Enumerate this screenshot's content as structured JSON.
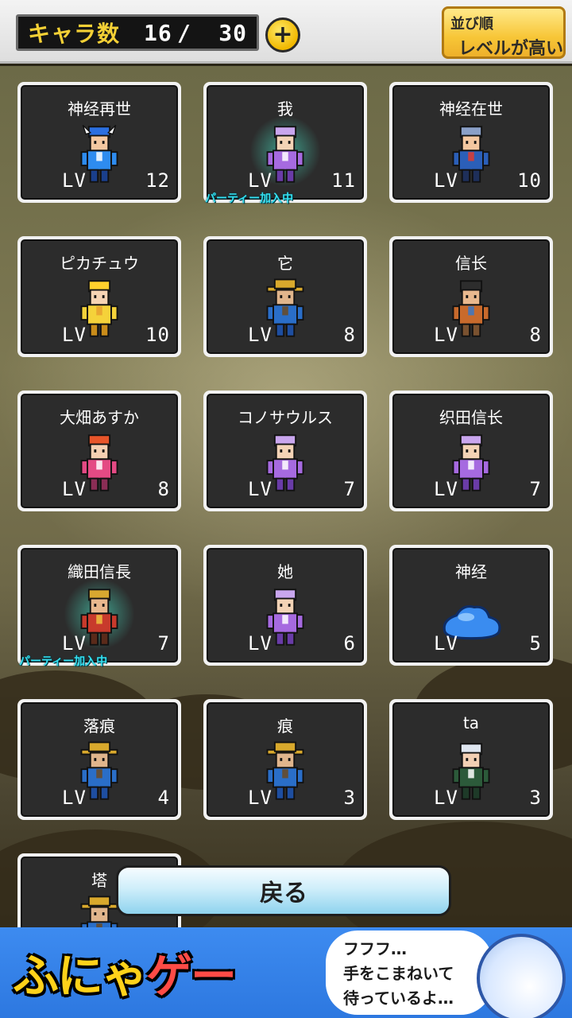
{
  "header": {
    "count_label": "キャラ数",
    "count_current": "16",
    "count_sep": "/",
    "count_max": "30",
    "plus_symbol": "+",
    "sort_label": "並び順",
    "sort_value": "レベルが高い"
  },
  "characters": [
    {
      "name": "神经再世",
      "lv_label": "LV",
      "lv": "12",
      "party": false,
      "sprite": "blue-knight-icon"
    },
    {
      "name": "我",
      "lv_label": "LV",
      "lv": "11",
      "party": true,
      "party_label": "パーティー加入中",
      "sprite": "purple-priest-icon"
    },
    {
      "name": "神经在世",
      "lv_label": "LV",
      "lv": "10",
      "party": false,
      "sprite": "shield-warrior-icon"
    },
    {
      "name": "ピカチュウ",
      "lv_label": "LV",
      "lv": "10",
      "party": false,
      "sprite": "jester-girl-icon"
    },
    {
      "name": "它",
      "lv_label": "LV",
      "lv": "8",
      "party": false,
      "sprite": "farmer-icon"
    },
    {
      "name": "信长",
      "lv_label": "LV",
      "lv": "8",
      "party": false,
      "sprite": "bandana-fighter-icon"
    },
    {
      "name": "大畑あすか",
      "lv_label": "LV",
      "lv": "8",
      "party": false,
      "sprite": "redhead-girl-icon"
    },
    {
      "name": "コノサウルス",
      "lv_label": "LV",
      "lv": "7",
      "party": false,
      "sprite": "purple-priest-icon"
    },
    {
      "name": "织田信长",
      "lv_label": "LV",
      "lv": "7",
      "party": false,
      "sprite": "purple-priest-icon"
    },
    {
      "name": "織田信長",
      "lv_label": "LV",
      "lv": "7",
      "party": true,
      "party_label": "パーティー加入中",
      "sprite": "samurai-icon"
    },
    {
      "name": "她",
      "lv_label": "LV",
      "lv": "6",
      "party": false,
      "sprite": "purple-priest-icon"
    },
    {
      "name": "神经",
      "lv_label": "LV",
      "lv": "5",
      "party": false,
      "sprite": "blue-slime-icon"
    },
    {
      "name": "落痕",
      "lv_label": "LV",
      "lv": "4",
      "party": false,
      "sprite": "farmer-icon"
    },
    {
      "name": "痕",
      "lv_label": "LV",
      "lv": "3",
      "party": false,
      "sprite": "farmer-icon"
    },
    {
      "name": "ta",
      "lv_label": "LV",
      "lv": "3",
      "party": false,
      "sprite": "hooded-monk-icon"
    },
    {
      "name": "塔",
      "lv_label": "",
      "lv": "",
      "party": false,
      "sprite": "farmer-icon"
    }
  ],
  "back_button": "戻る",
  "ad": {
    "logo_part1": "ふにゃ",
    "logo_part2": "ゲー",
    "line1": "フフフ…",
    "line2": "手をこまねいて",
    "line3": "待っているよ…"
  },
  "colors": {
    "count_label": "#f4d035",
    "party_tag": "#35e0f0",
    "sort_button": "#f7c637",
    "back_button": "#8fd3ee",
    "ad_background": "#2d78e0"
  }
}
